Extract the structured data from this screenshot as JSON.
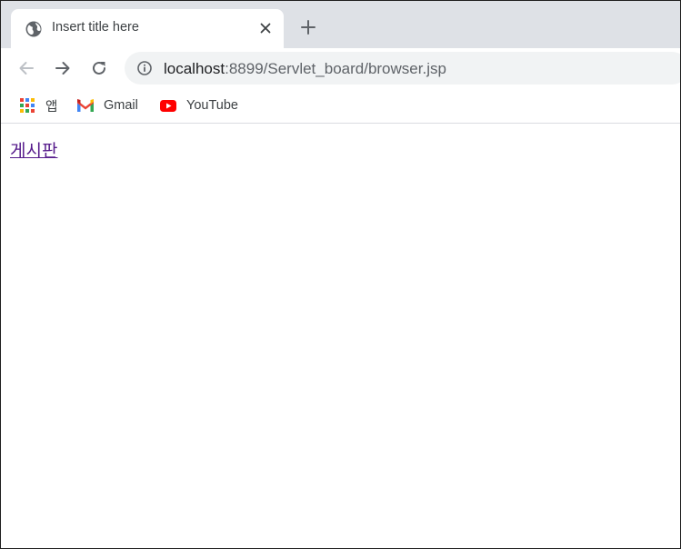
{
  "tab": {
    "title": "Insert title here",
    "favicon": "globe-icon"
  },
  "toolbar": {
    "url_host": "localhost",
    "url_path": ":8899/Servlet_board/browser.jsp"
  },
  "bookmarks": [
    {
      "label": "앱",
      "icon": "apps-grid-icon"
    },
    {
      "label": "Gmail",
      "icon": "gmail-icon"
    },
    {
      "label": "YouTube",
      "icon": "youtube-icon"
    }
  ],
  "content": {
    "link_label": "게시판"
  },
  "colors": {
    "tabstrip": "#dee1e6",
    "omnibox": "#f1f3f4",
    "visited_link": "#551a8b"
  }
}
